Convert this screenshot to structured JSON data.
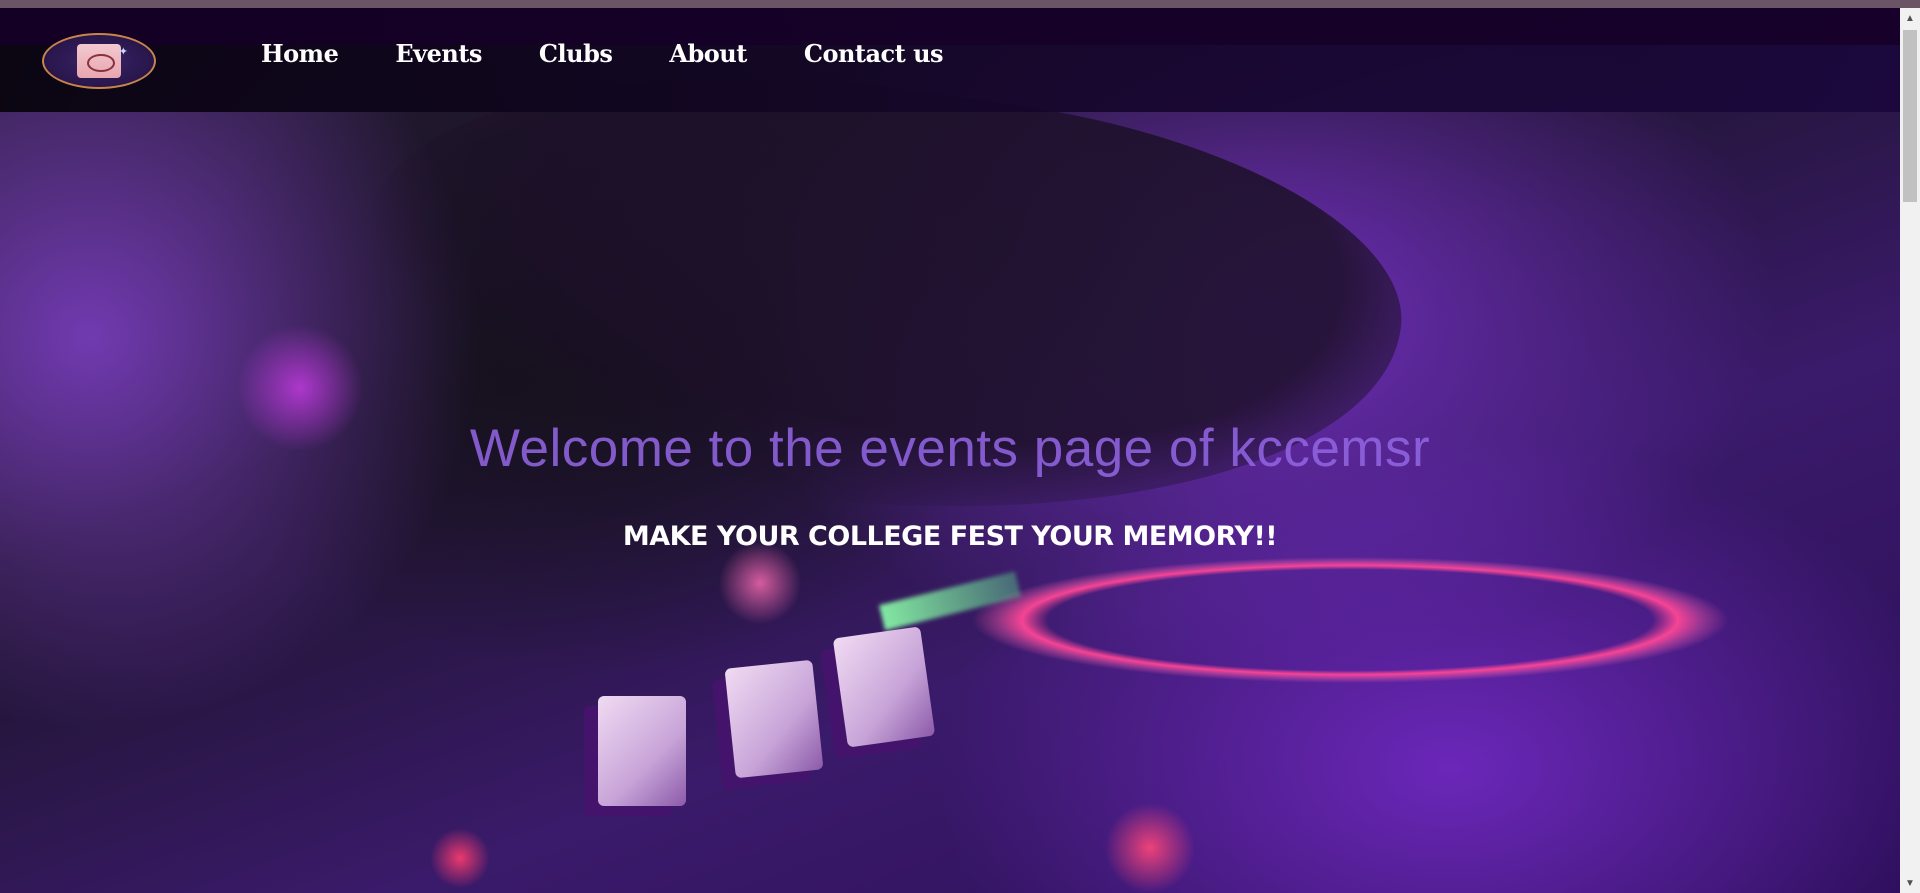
{
  "nav": {
    "items": [
      {
        "label": "Home"
      },
      {
        "label": "Events"
      },
      {
        "label": "Clubs"
      },
      {
        "label": "About"
      },
      {
        "label": "Contact us"
      }
    ],
    "logo_icon": "college-crest-logo"
  },
  "hero": {
    "headline": "Welcome to the events page of kccemsr",
    "subheadline": "MAKE YOUR COLLEGE FEST YOUR MEMORY!!",
    "background_image": "dj-mixer-purple-neon"
  },
  "scrollbar": {
    "up_icon": "scroll-up-arrow-icon",
    "down_icon": "scroll-down-arrow-icon"
  },
  "colors": {
    "headline": "#9164e1",
    "nav_text": "#ffffff",
    "accent_pink": "#ff4696",
    "accent_purple": "#6e28be"
  }
}
